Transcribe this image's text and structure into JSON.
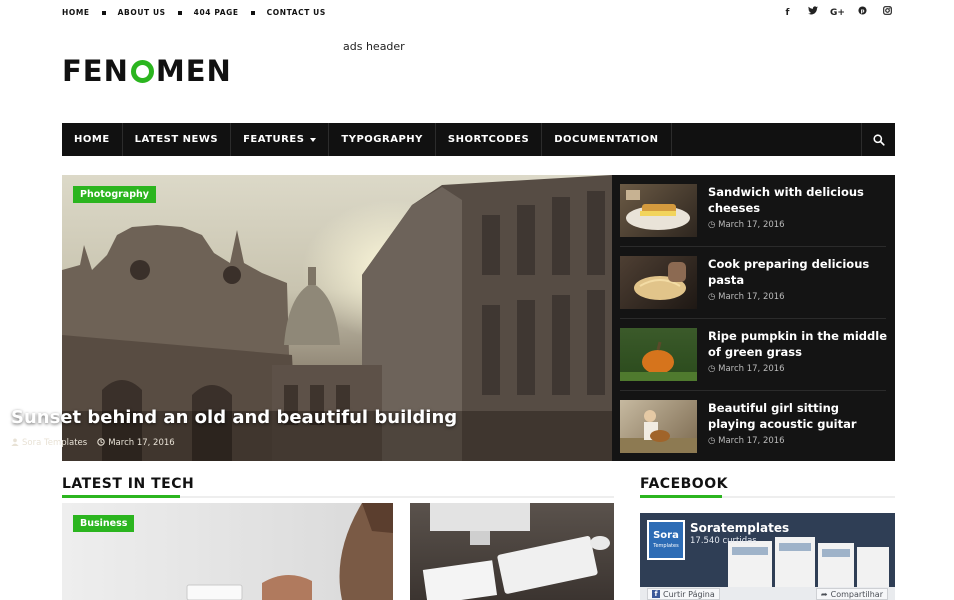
{
  "topbar": {
    "links": [
      "HOME",
      "ABOUT US",
      "404 PAGE",
      "CONTACT US"
    ],
    "socials": [
      "facebook-icon",
      "twitter-icon",
      "google-plus-icon",
      "pinterest-icon",
      "instagram-icon"
    ]
  },
  "header": {
    "logo_left": "FEN",
    "logo_right": "MEN",
    "ads": "ads header"
  },
  "nav": {
    "items": [
      "HOME",
      "LATEST NEWS",
      "FEATURES",
      "TYPOGRAPHY",
      "SHORTCODES",
      "DOCUMENTATION"
    ],
    "search_icon": "search-icon"
  },
  "featured": {
    "category": "Photography",
    "title": "Sunset behind an old and beautiful building",
    "author": "Sora Templates",
    "date": "March 17, 2016"
  },
  "side_posts": [
    {
      "title": "Sandwich with delicious cheeses",
      "date": "March 17, 2016"
    },
    {
      "title": "Cook preparing delicious pasta",
      "date": "March 17, 2016"
    },
    {
      "title": "Ripe pumpkin in the middle of green grass",
      "date": "March 17, 2016"
    },
    {
      "title": "Beautiful girl sitting playing acoustic guitar",
      "date": "March 17, 2016"
    }
  ],
  "latest_tech": {
    "heading": "LATEST IN TECH",
    "category": "Business"
  },
  "facebook": {
    "heading": "FACEBOOK",
    "page_name": "Soratemplates",
    "likes": "17.540 curtidas",
    "like_button": "Curtir Página",
    "share_button": "Compartilhar",
    "logo_top": "Sora",
    "logo_bottom": "Templates"
  },
  "colors": {
    "accent": "#2bb51f",
    "nav_bg": "#111111",
    "side_bg": "#141414"
  }
}
